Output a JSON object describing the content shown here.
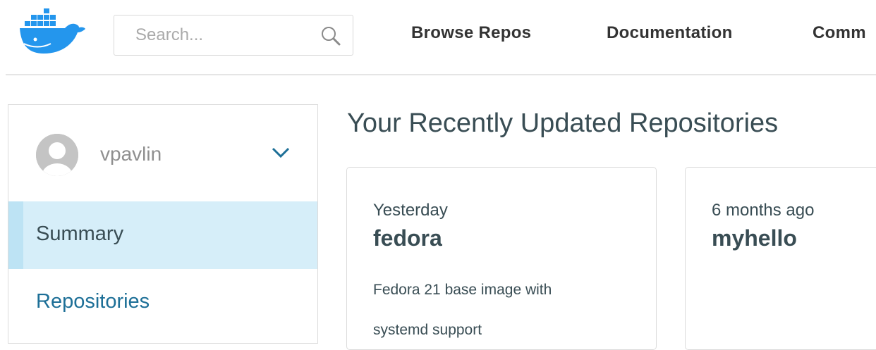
{
  "header": {
    "logo_name": "docker-whale-logo",
    "search": {
      "placeholder": "Search...",
      "value": ""
    },
    "nav": [
      {
        "label": "Browse Repos"
      },
      {
        "label": "Documentation"
      },
      {
        "label": "Comm"
      }
    ]
  },
  "sidebar": {
    "user": {
      "username": "vpavlin"
    },
    "items": [
      {
        "label": "Summary",
        "active": true
      },
      {
        "label": "Repositories",
        "active": false
      }
    ]
  },
  "main": {
    "title": "Your Recently Updated Repositories",
    "repos": [
      {
        "updated": "Yesterday",
        "name": "fedora",
        "description_line1": "Fedora 21 base image with",
        "description_line2": "systemd support"
      },
      {
        "updated": "6 months ago",
        "name": "myhello",
        "description_line1": "",
        "description_line2": ""
      }
    ]
  },
  "colors": {
    "brand_blue": "#2496ed",
    "active_bg": "#d6eef9",
    "active_bar": "#bde3f4",
    "link_blue": "#1d6f97",
    "text_dark": "#394d54"
  }
}
